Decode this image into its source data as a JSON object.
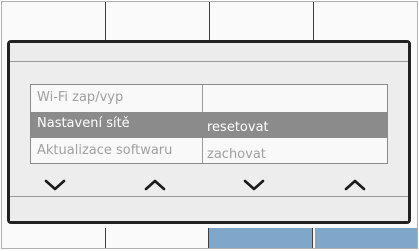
{
  "menu": {
    "items": [
      {
        "label": "Wi-Fi zap/vyp",
        "option": ""
      },
      {
        "label": "Nastavení sítě",
        "option": "resetovat"
      },
      {
        "label": "Aktualizace softwaru",
        "option": "zachovat"
      }
    ],
    "selected_index": 1
  },
  "nav": {
    "buttons": [
      "chevron-down-icon",
      "chevron-up-icon",
      "chevron-down-icon",
      "chevron-up-icon"
    ]
  },
  "colors": {
    "selected_row": "#8b8b8b",
    "active_softkey": "#7ea7c9",
    "dialog_border": "#222222"
  }
}
